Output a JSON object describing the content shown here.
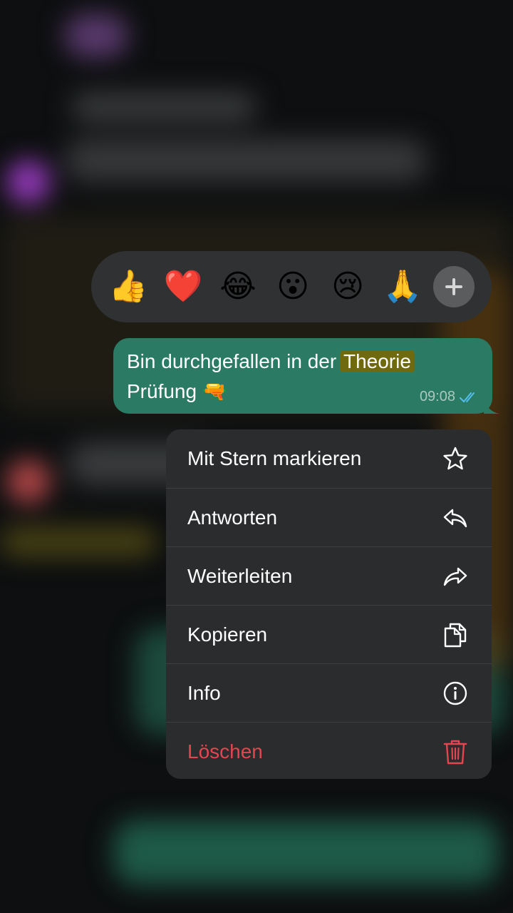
{
  "reactions": [
    {
      "name": "thumbs-up",
      "glyph": "👍"
    },
    {
      "name": "red-heart",
      "glyph": "❤️"
    },
    {
      "name": "face-with-tears-of-joy",
      "glyph": "😂"
    },
    {
      "name": "face-with-open-mouth",
      "glyph": "😮"
    },
    {
      "name": "crying-face",
      "glyph": "😢"
    },
    {
      "name": "folded-hands",
      "glyph": "🙏"
    }
  ],
  "more_reactions_icon": "plus-icon",
  "message": {
    "text_part1": "Bin durchgefallen in der",
    "highlighted": "Theorie",
    "text_line2": "Prüfung",
    "emoji": "🔫",
    "time": "09:08",
    "status_icon": "double-check-icon",
    "bubble_color": "#2b7a64",
    "highlight_color": "#6f6a10"
  },
  "menu": {
    "items": [
      {
        "label": "Mit Stern markieren",
        "icon": "star-icon"
      },
      {
        "label": "Antworten",
        "icon": "reply-icon"
      },
      {
        "label": "Weiterleiten",
        "icon": "forward-icon"
      },
      {
        "label": "Kopieren",
        "icon": "copy-icon"
      },
      {
        "label": "Info",
        "icon": "info-icon"
      },
      {
        "label": "Löschen",
        "icon": "trash-icon",
        "color": "#e5454f"
      }
    ]
  }
}
